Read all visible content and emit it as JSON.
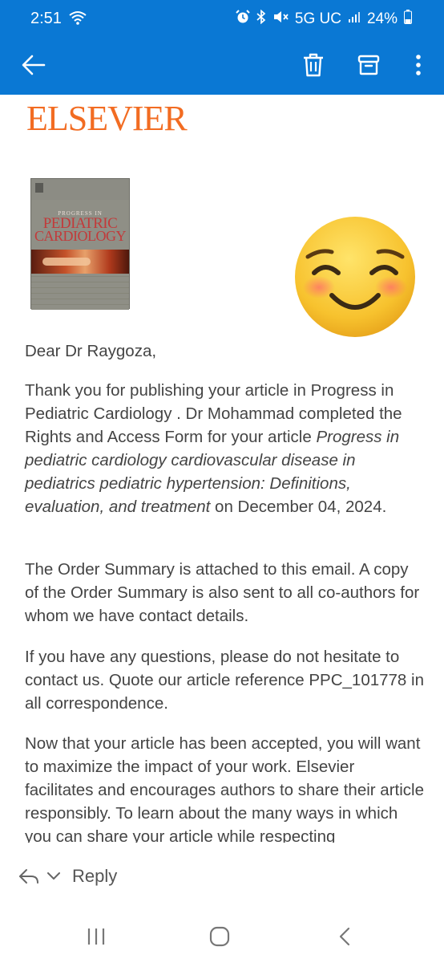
{
  "status_bar": {
    "time": "2:51",
    "network": "5G UC",
    "battery": "24%",
    "icons": [
      "wifi-icon",
      "alarm-icon",
      "bluetooth-icon",
      "mute-icon",
      "signal-icon",
      "battery-icon"
    ]
  },
  "app_bar": {
    "actions": [
      "back-arrow-icon",
      "trash-icon",
      "archive-icon",
      "more-vertical-icon"
    ],
    "color": "#0a78d4"
  },
  "email": {
    "logo_text": "ELSEVIER",
    "logo_color": "#f26c22",
    "cover": {
      "pre": "PROGRESS IN",
      "line1": "PEDIATRIC",
      "line2": "CARDIOLOGY"
    },
    "greeting": "Dear Dr Raygoza,",
    "p1_a": "Thank you for publishing your article in Progress in Pediatric Cardiology . Dr Mohammad completed the Rights and Access Form for your article ",
    "p1_italic": "Progress in pediatric cardiology cardiovascular disease in pediatrics pediatric hypertension: Definitions, evaluation, and treatment",
    "p1_b": " on December 04, 2024.",
    "p2": "The Order Summary is attached to this email. A copy of the Order Summary is also sent to all co-authors for whom we have contact details.",
    "p3": "If you have any questions, please do not hesitate to contact us. Quote our article reference PPC_101778 in all correspondence.",
    "p4": "Now that your article has been accepted, you will want to maximize the impact of your work. Elsevier facilitates and encourages authors to share their article responsibly. To learn about the many ways in which you can share your article while respecting"
  },
  "reply_bar": {
    "reply_label": "Reply"
  },
  "nav_bar": {
    "icons": [
      "recent-apps-icon",
      "home-icon",
      "back-icon"
    ]
  }
}
